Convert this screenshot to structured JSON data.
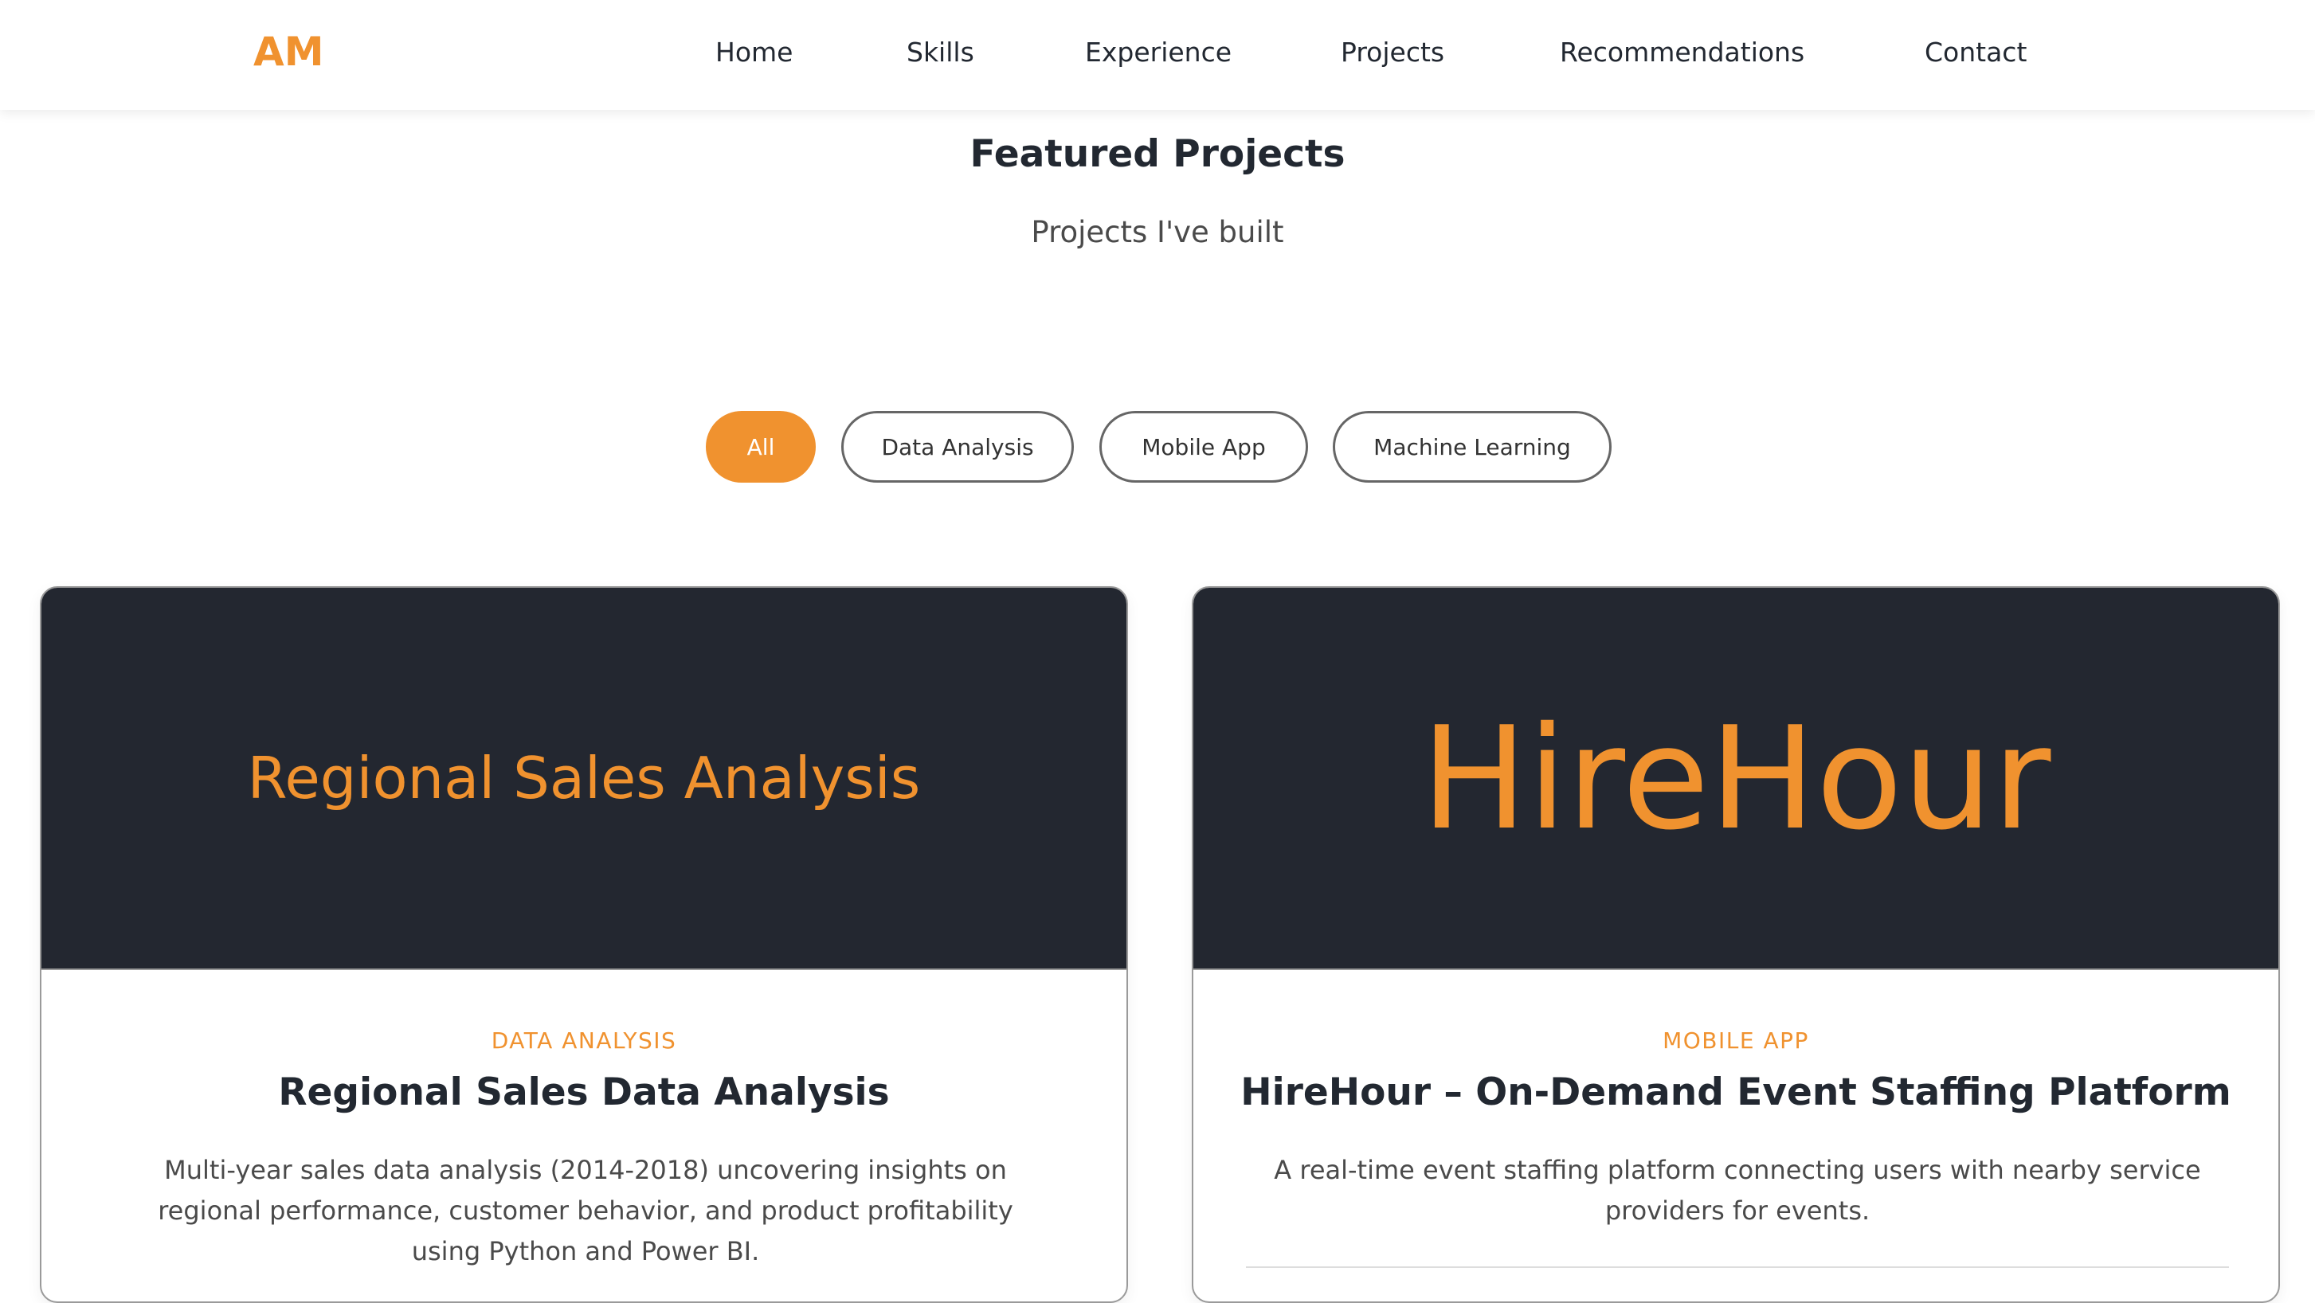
{
  "nav": {
    "logo": "AM",
    "links": [
      "Home",
      "Skills",
      "Experience",
      "Projects",
      "Recommendations",
      "Contact"
    ]
  },
  "section": {
    "title": "Featured Projects",
    "subtitle": "Projects I've built"
  },
  "filters": [
    {
      "label": "All",
      "active": true
    },
    {
      "label": "Data Analysis",
      "active": false
    },
    {
      "label": "Mobile App",
      "active": false
    },
    {
      "label": "Machine Learning",
      "active": false
    }
  ],
  "projects": [
    {
      "banner_text": "Regional Sales Analysis",
      "category": "DATA ANALYSIS",
      "title": "Regional Sales Data Analysis",
      "description": "Multi-year sales data analysis (2014-2018) uncovering insights on regional performance, customer behavior, and product profitability using Python and Power BI."
    },
    {
      "banner_text": "HireHour",
      "category": "MOBILE APP",
      "title": "HireHour – On-Demand Event Staffing Platform",
      "description": "A real-time event staffing platform connecting users with nearby service providers for events."
    }
  ],
  "colors": {
    "accent": "#f0922f",
    "banner_bg": "#232730",
    "text_dark": "#222831"
  }
}
